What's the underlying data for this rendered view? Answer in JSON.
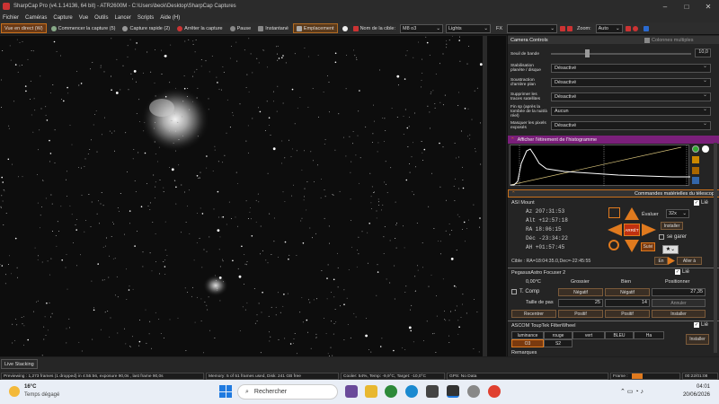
{
  "window": {
    "title": "SharpCap Pro (v4.1.14136, 64 bit) - ATR2600M - C:\\Users\\beck\\Desktop\\SharpCap Captures"
  },
  "menu": [
    "Fichier",
    "Caméras",
    "Capture",
    "Vue",
    "Outils",
    "Lancer",
    "Scripts",
    "Aide (H)"
  ],
  "toolbar": {
    "live": "Vue en direct (W)",
    "start": "Commencer la capture (5)",
    "quick": "Capture rapide (2)",
    "stop": "Arrêter la capture",
    "pause": "Pause",
    "snapshot": "Instantané",
    "placement": "Emplacement",
    "target_label": "Nom de la cible:",
    "target_value": "M8 o3",
    "frame_type": "Lights",
    "fx": "FX",
    "zoom_label": "Zoom:",
    "zoom_value": "Auto"
  },
  "panel": {
    "camera_controls": "Camera Controls",
    "multi_columns": "Colonnes multiples",
    "band_threshold": "Seuil de bande",
    "band_value": "10,0",
    "rows": [
      {
        "label": "Stabilisation planète / disque",
        "value": "Désactivé"
      },
      {
        "label": "Soustraction d'arrière plan",
        "value": "Désactivé"
      },
      {
        "label": "Supprimer les traces satellites",
        "value": "Désactivé"
      },
      {
        "label": "Fin sp (après la tombée de la nuit/à réel)",
        "value": "Aucun"
      },
      {
        "label": "Masquer les pixels exposés",
        "value": "Désactivé"
      }
    ],
    "histogram": "Afficher l'étirement de l'histogramme",
    "telescope": "Commandes matérielles du télescope",
    "mount": {
      "name": "ASI Mount",
      "linked": "Lié",
      "az": "Az   207:31:53",
      "alt": "Alt  +12:57:18",
      "ra": "RA   18:06:15",
      "dec": "Déc  -23:34:22",
      "ah": "AH   +01:57:45",
      "evaluate": "Évaluer",
      "rate": "32x",
      "install": "Installer",
      "park": "se garer",
      "stop": "ARRÊT",
      "follow": "Suivi",
      "target": "Cible : RA=18:04:35.0,Dec=-22:45:55",
      "en": "En",
      "goto": "Aller à"
    },
    "focuser": {
      "name": "PegasusAstro Focuser 2",
      "linked": "Lié",
      "temp": "0,00°C",
      "coarse": "Grossier",
      "fine": "Bien",
      "position": "Positionner",
      "tcomp": "T. Comp",
      "neg1": "Négatif",
      "neg2": "Négatif",
      "pos_val": "27,35",
      "step_label": "Taille de pas",
      "step1": "25",
      "step2": "14",
      "cancel": "Annuler",
      "recenter": "Recentrer",
      "posi1": "Positif",
      "posi2": "Positif",
      "install": "Installer"
    },
    "filterwheel": {
      "name": "ASCOM ToupTek FilterWheel",
      "linked": "Lié",
      "filters": [
        "luminance",
        "rouge",
        "vert",
        "BLEU",
        "Ha",
        "O3",
        "S2"
      ],
      "install": "Installer"
    },
    "remarks": "Remarques"
  },
  "status": {
    "live_stacking": "Live Stacking",
    "frames": "Previewing : 1,273 frames (1 dropped) in 4:55:56, exposure 90,0s , last frame 90,0s",
    "memory": "Memory: 5 of 51 frames used, Disk: 241 GB free",
    "cooler": "Cooler: 54%, Temp: -9,9°C, Target: -10,0°C",
    "gps": "GPS: No Data",
    "frame": "Frame :",
    "timer": "00:22/01:08"
  },
  "taskbar": {
    "temp": "16°C",
    "weather": "Temps dégagé",
    "search": "Rechercher",
    "time": "04:01",
    "date": "20/06/2026"
  }
}
